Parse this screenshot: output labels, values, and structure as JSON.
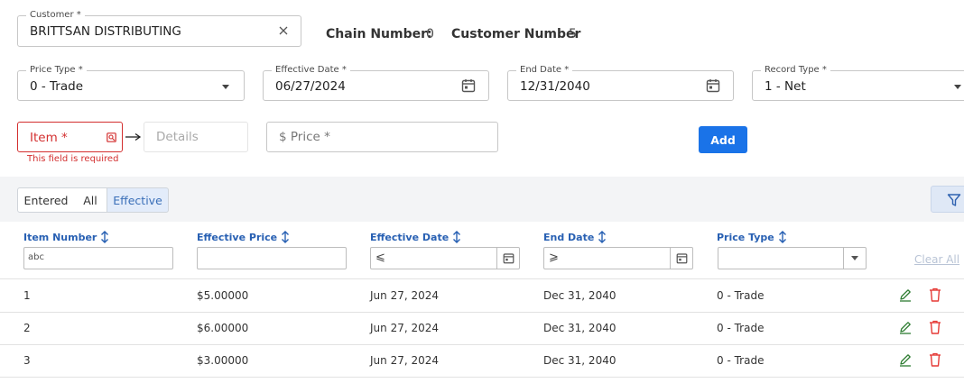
{
  "form": {
    "customer": {
      "label": "Customer *",
      "value": "BRITTSAN DISTRIBUTING"
    },
    "chain_number": {
      "label": "Chain Number:",
      "value": "0"
    },
    "customer_number": {
      "label": "Customer Number",
      "value": "5"
    },
    "price_type": {
      "label": "Price Type *",
      "value": "0 - Trade"
    },
    "effective_date": {
      "label": "Effective Date *",
      "value": "06/27/2024"
    },
    "end_date": {
      "label": "End Date *",
      "value": "12/31/2040"
    },
    "record_type": {
      "label": "Record Type *",
      "value": "1 - Net"
    },
    "item": {
      "placeholder": "Item *",
      "error": "This field is required"
    },
    "details": {
      "placeholder": "Details"
    },
    "price": {
      "placeholder": "$ Price *"
    },
    "add_label": "Add"
  },
  "toolbar": {
    "segments": [
      {
        "label": "Entered",
        "active": false
      },
      {
        "label": "All",
        "active": false
      },
      {
        "label": "Effective",
        "active": true
      }
    ]
  },
  "table": {
    "columns": [
      "Item Number",
      "Effective Price",
      "Effective Date",
      "End Date",
      "Price Type"
    ],
    "filters": {
      "item_placeholder": "a͏b͏c",
      "effective_date_op": "⩽",
      "end_date_op": "⩾"
    },
    "clear_all": "Clear All",
    "rows": [
      {
        "item": "1",
        "price": "$5.00000",
        "effective": "Jun 27, 2024",
        "end": "Dec 31, 2040",
        "type": "0 - Trade"
      },
      {
        "item": "2",
        "price": "$6.00000",
        "effective": "Jun 27, 2024",
        "end": "Dec 31, 2040",
        "type": "0 - Trade"
      },
      {
        "item": "3",
        "price": "$3.00000",
        "effective": "Jun 27, 2024",
        "end": "Dec 31, 2040",
        "type": "0 - Trade"
      }
    ]
  },
  "colors": {
    "accent": "#1a73e8",
    "error": "#d32f2f",
    "edit": "#2e7d32",
    "delete": "#e53935",
    "header_text": "#2860b3"
  }
}
